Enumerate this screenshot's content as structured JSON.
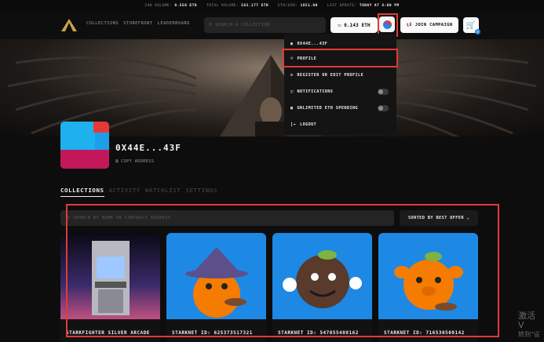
{
  "stats": {
    "vol24_label": "24H VOLUME:",
    "vol24_value": "0.550 ETH",
    "total_label": "TOTAL VOLUME:",
    "total_value": "582.177 ETH",
    "ethusd_label": "ETH/USD:",
    "ethusd_value": "1851.00",
    "update_label": "LAST UPDATE:",
    "update_value": "TODAY AT 8:00 PM"
  },
  "nav": {
    "links": [
      "COLLECTIONS",
      "STOREFRONT",
      "LEADERBOARD"
    ],
    "search_placeholder": "SEARCH A COLLECTION",
    "wallet_balance": "0.143 ETH",
    "join_label": "JOIN CAMPAIGN",
    "cart_count": "0"
  },
  "menu": {
    "items": [
      {
        "label": "0X44E...43F",
        "icon": "wallet-icon"
      },
      {
        "label": "PROFILE",
        "icon": "user-icon"
      },
      {
        "label": "REGISTER OR EDIT PROFILE",
        "icon": "settings-icon"
      },
      {
        "label": "NOTIFICATIONS",
        "icon": "bell-icon"
      },
      {
        "label": "UNLIMITED ETH SPENDING",
        "icon": "eth-icon"
      },
      {
        "label": "LOGOUT",
        "icon": "logout-icon"
      }
    ]
  },
  "profile": {
    "username": "0X44E...43F",
    "copy_label": "COPY ADDRESS"
  },
  "tabs": [
    "COLLECTIONS",
    "ACTIVITY",
    "WATCHLIST",
    "SETTINGS"
  ],
  "filter": {
    "placeholder": "SEARCH BY NAME OR CONTRACT ADDRESS",
    "sort_label": "SORTED BY BEST OFFER"
  },
  "cards": [
    {
      "title": "STARKFIGHTER SILVER ARCADE"
    },
    {
      "title": "STARKNET ID: 625373517321"
    },
    {
      "title": "STARKNET ID: 547055408162"
    },
    {
      "title": "STARKNET ID: 716530500142"
    }
  ],
  "watermark": {
    "line1": "激活 V",
    "line2": "转到\"设"
  },
  "colors": {
    "highlight": "#e53935",
    "background": "#0d0d0d",
    "card_blue": "#1e88e5"
  }
}
